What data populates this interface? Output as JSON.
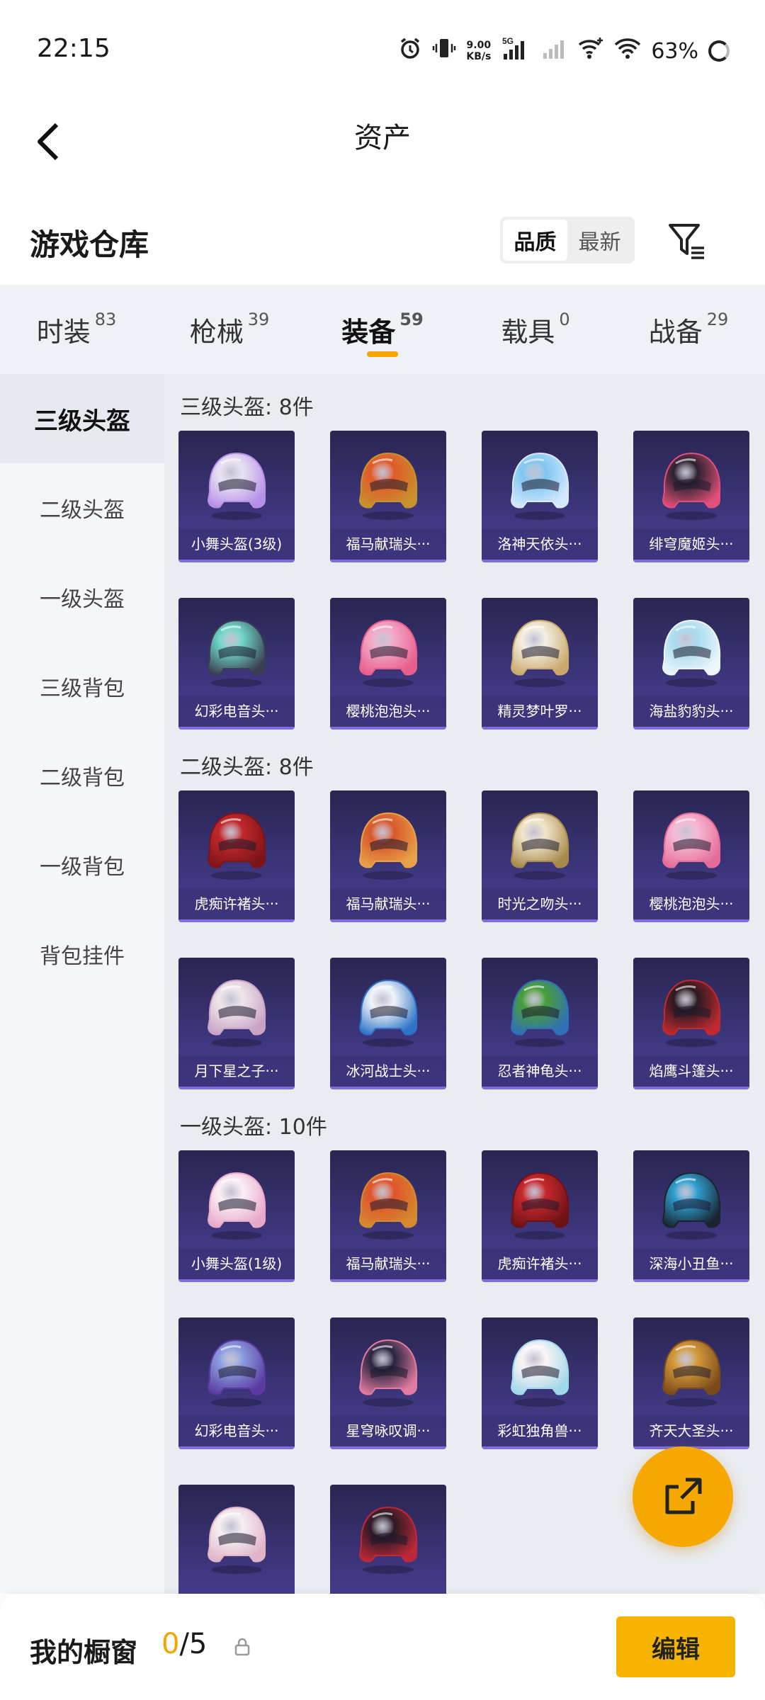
{
  "status": {
    "time": "22:15",
    "net_speed_value": "9.00",
    "net_speed_unit": "KB/s",
    "network": "5G",
    "battery": "63%"
  },
  "nav": {
    "title": "资产"
  },
  "warehouse": {
    "title": "游戏仓库",
    "sort_options": [
      "品质",
      "最新"
    ]
  },
  "tabs": [
    {
      "label": "时装",
      "count": "83"
    },
    {
      "label": "枪械",
      "count": "39"
    },
    {
      "label": "装备",
      "count": "59"
    },
    {
      "label": "载具",
      "count": "0"
    },
    {
      "label": "战备",
      "count": "29"
    }
  ],
  "sidebar": [
    "三级头盔",
    "二级头盔",
    "一级头盔",
    "三级背包",
    "二级背包",
    "一级背包",
    "背包挂件"
  ],
  "sections": [
    {
      "title": "三级头盔: 8件",
      "items": [
        {
          "name": "小舞头盔(3级)",
          "c1": "#e8e2f2",
          "c2": "#b68fe8"
        },
        {
          "name": "福马献瑞头···",
          "c1": "#e05a2a",
          "c2": "#c8922e"
        },
        {
          "name": "洛神天依头···",
          "c1": "#7fc6ef",
          "c2": "#d7e9ff"
        },
        {
          "name": "绯穹魔姬头···",
          "c1": "#2b2030",
          "c2": "#e0507a"
        },
        {
          "name": "幻彩电音头···",
          "c1": "#6fd6c8",
          "c2": "#3b3f52"
        },
        {
          "name": "樱桃泡泡头···",
          "c1": "#f4a9c8",
          "c2": "#e85d8c"
        },
        {
          "name": "精灵梦叶罗···",
          "c1": "#f4efe2",
          "c2": "#c9a86b"
        },
        {
          "name": "海盐豹豹头···",
          "c1": "#a8dcef",
          "c2": "#eef6fb"
        }
      ]
    },
    {
      "title": "二级头盔: 8件",
      "items": [
        {
          "name": "虎痴许褚头···",
          "c1": "#c0282a",
          "c2": "#7d1418"
        },
        {
          "name": "福马献瑞头···",
          "c1": "#d8582a",
          "c2": "#e8a24a"
        },
        {
          "name": "时光之吻头···",
          "c1": "#f1e5c8",
          "c2": "#a8894c"
        },
        {
          "name": "樱桃泡泡头···",
          "c1": "#f7b9d3",
          "c2": "#e56b98"
        },
        {
          "name": "月下星之子···",
          "c1": "#efe6ea",
          "c2": "#c9a2c6"
        },
        {
          "name": "冰河战士头···",
          "c1": "#f0f4f8",
          "c2": "#2f73c8"
        },
        {
          "name": "忍者神龟头···",
          "c1": "#4a9e3a",
          "c2": "#2f6fb8"
        },
        {
          "name": "焰鹰斗篷头···",
          "c1": "#2a1a20",
          "c2": "#c02a30"
        }
      ]
    },
    {
      "title": "一级头盔: 10件",
      "items": [
        {
          "name": "小舞头盔(1级)",
          "c1": "#fbeef5",
          "c2": "#e8a9c8"
        },
        {
          "name": "福马献瑞头···",
          "c1": "#e0542a",
          "c2": "#d58a30"
        },
        {
          "name": "虎痴许褚头···",
          "c1": "#c7282c",
          "c2": "#6e1216"
        },
        {
          "name": "深海小丑鱼···",
          "c1": "#2f9fcf",
          "c2": "#1a2430"
        },
        {
          "name": "幻彩电音头···",
          "c1": "#8a9de0",
          "c2": "#5a3aa0"
        },
        {
          "name": "星穹咏叹调···",
          "c1": "#2a2440",
          "c2": "#e27ca0"
        },
        {
          "name": "彩虹独角兽···",
          "c1": "#fbf4f6",
          "c2": "#9fd8e8"
        },
        {
          "name": "齐天大圣头···",
          "c1": "#d49a3a",
          "c2": "#7a4a1a"
        },
        {
          "name": "",
          "c1": "#f5eef2",
          "c2": "#e0b3c8"
        },
        {
          "name": "",
          "c1": "#2a1a24",
          "c2": "#c0283a"
        }
      ]
    }
  ],
  "showcase": {
    "label": "我的橱窗",
    "current": "0",
    "total": "/5",
    "edit_label": "编辑"
  },
  "colors": {
    "accent": "#f5a400",
    "card": "#3b3478"
  }
}
